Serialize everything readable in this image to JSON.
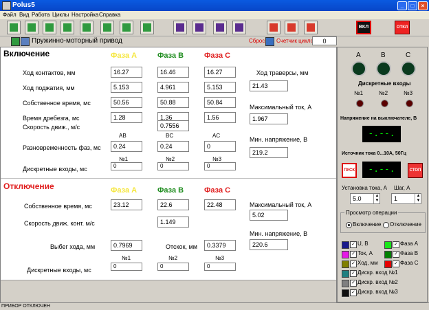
{
  "window": {
    "title": "Polus5",
    "controls": [
      "_",
      "□",
      "×"
    ]
  },
  "menu": [
    "Файл",
    "Вид",
    "Работа",
    "Циклы",
    "Настройка",
    "Справка"
  ],
  "toolbar": {
    "buttons": [
      {
        "name": "new-icon",
        "color": "#2f9a3f"
      },
      {
        "name": "open-icon",
        "color": "#2f9a3f"
      },
      {
        "name": "search-icon",
        "color": "#2f9a3f"
      },
      {
        "name": "table-icon",
        "color": "#2f9a3f"
      },
      {
        "name": "disk-icon",
        "color": "#2f9a3f"
      },
      {
        "name": "chart-icon",
        "color": "#2f9a3f"
      },
      {
        "name": "save-icon",
        "color": "#2f9a3f"
      },
      {
        "name": "print-icon",
        "color": "#2f9a3f"
      },
      {
        "name": "hammer-icon",
        "color": "#5a2c8f"
      },
      {
        "name": "arrows-icon",
        "color": "#5a2c8f"
      },
      {
        "name": "grid-icon",
        "color": "#5a2c8f"
      },
      {
        "name": "wave-icon",
        "color": "#5a2c8f"
      },
      {
        "name": "gear1-icon",
        "color": "#d83a2c"
      },
      {
        "name": "gear2-icon",
        "color": "#d83a2c"
      },
      {
        "name": "gear3-icon",
        "color": "#d83a2c"
      }
    ],
    "on_label": "ВКЛ",
    "off_label": "ОТКЛ"
  },
  "header": {
    "drive_title": "Пружинно-моторный привод",
    "reset_label": "Сброс",
    "cycle_counter_label": "Счетчик циклов",
    "cycle_count": "0"
  },
  "phases": {
    "a": "Фаза A",
    "b": "Фаза B",
    "c": "Фаза C",
    "colors": {
      "a": "#f5e63c",
      "b": "#1e8c1e",
      "c": "#e01e1e"
    }
  },
  "on_section": {
    "title": "Включение",
    "rows": [
      {
        "label": "Ход контактов, мм",
        "a": "16.27",
        "b": "16.46",
        "c": "16.27"
      },
      {
        "label": "Ход поджатия, мм",
        "a": "5.153",
        "b": "4.961",
        "c": "5.153"
      },
      {
        "label": "Собственное время, мс",
        "a": "50.56",
        "b": "50.88",
        "c": "50.84"
      },
      {
        "label": "Время дребезга, мс",
        "a": "1.28",
        "b": "1.36",
        "c": "1.56"
      }
    ],
    "speed_label": "Скорость движ., м/с",
    "speed_value": "0.7556",
    "async_label": "Разновременность фаз, мс",
    "async_headers": {
      "ab": "AB",
      "bc": "BC",
      "ac": "AC"
    },
    "async_values": {
      "ab": "0.24",
      "bc": "0.24",
      "ac": "0"
    },
    "discrete_label": "Дискретные входы, мс",
    "discrete_headers": {
      "n1": "№1",
      "n2": "№2",
      "n3": "№3"
    },
    "discrete_values": {
      "n1": "0",
      "n2": "0",
      "n3": "0"
    },
    "traverse_label": "Ход траверсы, мм",
    "traverse_value": "21.43",
    "max_current_label": "Максимальный ток, А",
    "max_current_value": "1.967",
    "min_voltage_label": "Мин. напряжение, В",
    "min_voltage_value": "219.2"
  },
  "off_section": {
    "title": "Отключение",
    "own_time_label": "Собственное время, мс",
    "own_time": {
      "a": "23.12",
      "b": "22.6",
      "c": "22.48"
    },
    "speed_label": "Скорость движ. конт. м/с",
    "speed_value": "1.149",
    "overtravel_label": "Выбег хода, мм",
    "overtravel_value": "0.7969",
    "rebound_label": "Отскок, мм",
    "rebound_value": "0.3379",
    "discrete_label": "Дискретные входы, мс",
    "discrete_headers": {
      "n1": "№1",
      "n2": "№2",
      "n3": "№3"
    },
    "discrete_values": {
      "n1": "0",
      "n2": "0",
      "n3": "0"
    },
    "max_current_label": "Максимальный ток, А",
    "max_current_value": "5.02",
    "min_voltage_label": "Мин. напряжение, В",
    "min_voltage_value": "220.6"
  },
  "right_panel": {
    "phase_letters": {
      "a": "A",
      "b": "B",
      "c": "C"
    },
    "discrete_title": "Дискретные входы",
    "discrete_labels": {
      "n1": "№1",
      "n2": "№2",
      "n3": "№3"
    },
    "voltage_title": "Напряжение на выключателе, В",
    "voltage_display": "-.--.",
    "source_title": "Источник тока 0...10А, 50Гц",
    "current_display": "-.--.",
    "start_label": "ПУСК",
    "stop_label": "СТОП",
    "current_set_label": "Установка тока, А",
    "current_set_value": "5.0",
    "step_label": "Шаг, А",
    "step_value": "1",
    "operation_view_label": "Просмотр операции",
    "radio_on": "Включение",
    "radio_off": "Отключение",
    "legend": [
      {
        "label": "U, В",
        "color": "#1a1a8c"
      },
      {
        "label": "Фаза А",
        "color": "#19e619"
      },
      {
        "label": "Ток, А",
        "color": "#e619e6"
      },
      {
        "label": "Фаза В",
        "color": "#008000"
      },
      {
        "label": "Ход, мм",
        "color": "#808000"
      },
      {
        "label": "Фаза С",
        "color": "#e60000"
      },
      {
        "label": "Дискр. вход №1",
        "color": "#208080"
      },
      {
        "label": "Дискр. вход №2",
        "color": "#808080"
      },
      {
        "label": "Дискр. вход №3",
        "color": "#101010"
      }
    ]
  },
  "status": {
    "text": "ПРИБОР ОТКЛЮЧЕН"
  },
  "chart_data": {
    "type": "table",
    "title": "",
    "columns": [
      "Фаза A",
      "Фаза B",
      "Фаза C"
    ],
    "rows": [
      {
        "label": "Ход контактов, мм",
        "values": [
          16.27,
          16.46,
          16.27
        ]
      },
      {
        "label": "Ход поджатия, мм",
        "values": [
          5.153,
          4.961,
          5.153
        ]
      },
      {
        "label": "Собственное время, мс",
        "values": [
          50.56,
          50.88,
          50.84
        ]
      },
      {
        "label": "Время дребезга, мс",
        "values": [
          1.28,
          1.36,
          1.56
        ]
      },
      {
        "label": "Собственное время, мс",
        "values": [
          23.12,
          22.6,
          22.48
        ]
      }
    ]
  }
}
